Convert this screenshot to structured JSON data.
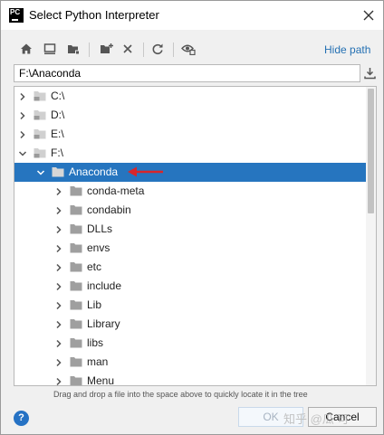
{
  "titlebar": {
    "title": "Select Python Interpreter"
  },
  "toolbar": {
    "hide_path_label": "Hide path"
  },
  "path_field": {
    "value": "F:\\Anaconda"
  },
  "tree": {
    "rows": [
      {
        "label": "C:\\",
        "level": 1,
        "expanded": false,
        "kind": "drive",
        "selected": false
      },
      {
        "label": "D:\\",
        "level": 1,
        "expanded": false,
        "kind": "drive",
        "selected": false
      },
      {
        "label": "E:\\",
        "level": 1,
        "expanded": false,
        "kind": "drive",
        "selected": false
      },
      {
        "label": "F:\\",
        "level": 1,
        "expanded": true,
        "kind": "drive",
        "selected": false
      },
      {
        "label": "Anaconda",
        "level": 2,
        "expanded": true,
        "kind": "folder",
        "selected": true
      },
      {
        "label": "conda-meta",
        "level": 3,
        "expanded": false,
        "kind": "folder",
        "selected": false
      },
      {
        "label": "condabin",
        "level": 3,
        "expanded": false,
        "kind": "folder",
        "selected": false
      },
      {
        "label": "DLLs",
        "level": 3,
        "expanded": false,
        "kind": "folder",
        "selected": false
      },
      {
        "label": "envs",
        "level": 3,
        "expanded": false,
        "kind": "folder",
        "selected": false
      },
      {
        "label": "etc",
        "level": 3,
        "expanded": false,
        "kind": "folder",
        "selected": false
      },
      {
        "label": "include",
        "level": 3,
        "expanded": false,
        "kind": "folder",
        "selected": false
      },
      {
        "label": "Lib",
        "level": 3,
        "expanded": false,
        "kind": "folder",
        "selected": false
      },
      {
        "label": "Library",
        "level": 3,
        "expanded": false,
        "kind": "folder",
        "selected": false
      },
      {
        "label": "libs",
        "level": 3,
        "expanded": false,
        "kind": "folder",
        "selected": false
      },
      {
        "label": "man",
        "level": 3,
        "expanded": false,
        "kind": "folder",
        "selected": false
      },
      {
        "label": "Menu",
        "level": 3,
        "expanded": false,
        "kind": "folder",
        "selected": false
      }
    ]
  },
  "hint": "Drag and drop a file into the space above to quickly locate it in the tree",
  "footer": {
    "help_label": "?",
    "ok_label": "OK",
    "cancel_label": "Cancel",
    "watermark": "知乎 @瓜 可"
  },
  "colors": {
    "selection": "#2675bf",
    "link": "#2470b3",
    "arrow": "#d9262a",
    "help": "#2672c4"
  }
}
